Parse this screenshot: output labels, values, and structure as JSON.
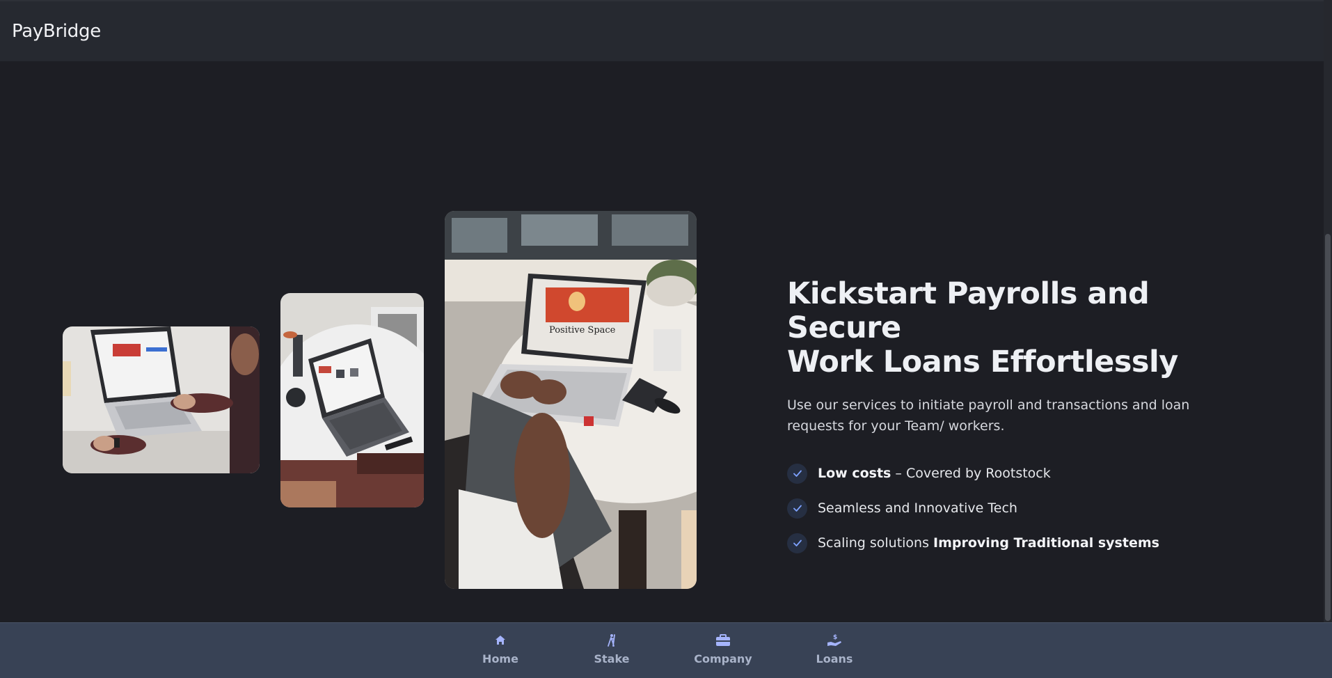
{
  "header": {
    "brand": "PayBridge"
  },
  "hero": {
    "headline_line1": "Kickstart Payrolls and Secure",
    "headline_line2": "Work Loans Effortlessly",
    "subtext": "Use our services to initiate payroll and transactions and loan requests for your Team/ workers.",
    "features": [
      {
        "bold": "Low costs",
        "rest": " – Covered by Rootstock"
      },
      {
        "plain": "Seamless and Innovative Tech"
      },
      {
        "plain": "Scaling solutions ",
        "bold": "Improving Traditional systems"
      }
    ],
    "images": [
      {
        "icon": "photo-laptop-desk-man"
      },
      {
        "icon": "photo-laptop-table-top"
      },
      {
        "icon": "photo-woman-typing-laptop",
        "screen_text": "Positive Space"
      }
    ]
  },
  "bottom_nav": {
    "items": [
      {
        "label": "Home",
        "icon": "home-icon"
      },
      {
        "label": "Stake",
        "icon": "stake-icon"
      },
      {
        "label": "Company",
        "icon": "briefcase-icon"
      },
      {
        "label": "Loans",
        "icon": "loan-hand-icon"
      }
    ]
  },
  "colors": {
    "background": "#1d1e24",
    "topbar": "#262930",
    "bottombar": "#384255",
    "nav_icon": "#a5b4fc",
    "check": "#7ea2ff"
  }
}
